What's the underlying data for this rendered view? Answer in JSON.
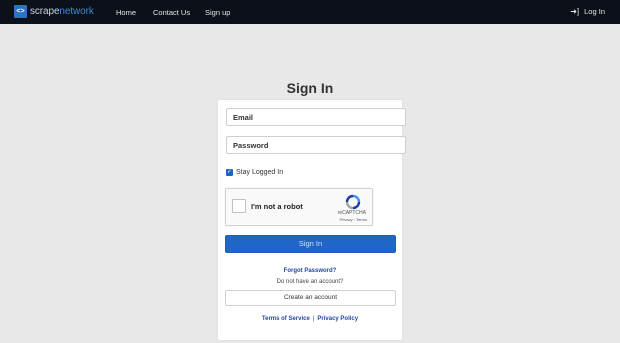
{
  "nav": {
    "brand_mark": "<>",
    "brand_part1": "scrape",
    "brand_part2": "network",
    "links": [
      "Home",
      "Contact Us",
      "Sign up"
    ],
    "login_label": "Log In",
    "login_icon": "sign-in-icon"
  },
  "form": {
    "title": "Sign In",
    "email_placeholder": "Email",
    "password_placeholder": "Password",
    "stay_logged_in_label": "Stay Logged In",
    "stay_logged_in_checked": true,
    "recaptcha": {
      "label": "I'm not a robot",
      "brand": "reCAPTCHA",
      "links": "Privacy - Terms"
    },
    "submit_label": "Sign In",
    "forgot_password": "Forgot Password?",
    "no_account_text": "Do not have an account?",
    "create_account_label": "Create an account",
    "terms_label": "Terms of Service",
    "footer_separator": "|",
    "privacy_label": "Privacy Policy"
  },
  "colors": {
    "navbar": "#0c1019",
    "primary": "#2166c7",
    "link": "#24489d",
    "page_bg": "#e8e8e8"
  }
}
